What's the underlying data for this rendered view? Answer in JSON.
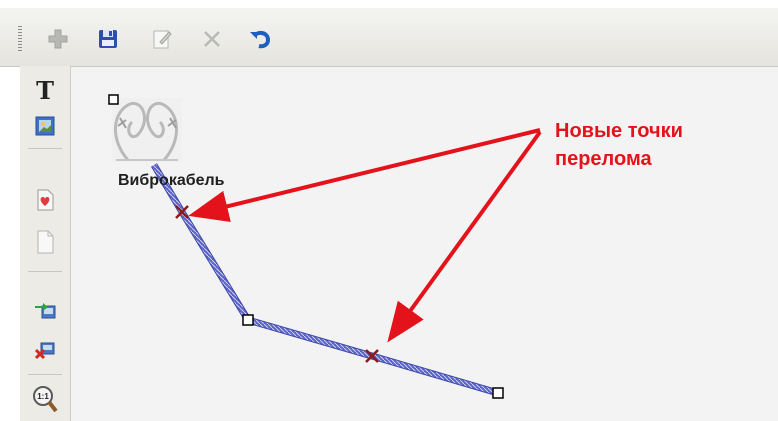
{
  "toolbar": {
    "buttons": [
      {
        "name": "add-icon",
        "enabled": false
      },
      {
        "name": "save-icon",
        "enabled": true
      },
      {
        "name": "edit-icon",
        "enabled": false
      },
      {
        "name": "delete-icon",
        "enabled": false
      },
      {
        "name": "undo-icon",
        "enabled": true
      }
    ]
  },
  "sidebar": {
    "tools": [
      {
        "name": "text-tool",
        "glyph": "T"
      },
      {
        "name": "image-tool-icon"
      },
      {
        "name": "favorite-page-icon"
      },
      {
        "name": "blank-page-icon"
      },
      {
        "name": "transfer-icon"
      },
      {
        "name": "remove-link-icon"
      },
      {
        "name": "zoom-actual-size-icon",
        "glyph": "1:1"
      }
    ]
  },
  "diagram": {
    "device_label": "Виброкабель",
    "device_icon": "barbed-wire-icon",
    "cable_color": "#5b63c7",
    "new_point_color": "#8b1a1a"
  },
  "annotation": {
    "text": "Новые точки перелома",
    "color": "#e4131b"
  }
}
